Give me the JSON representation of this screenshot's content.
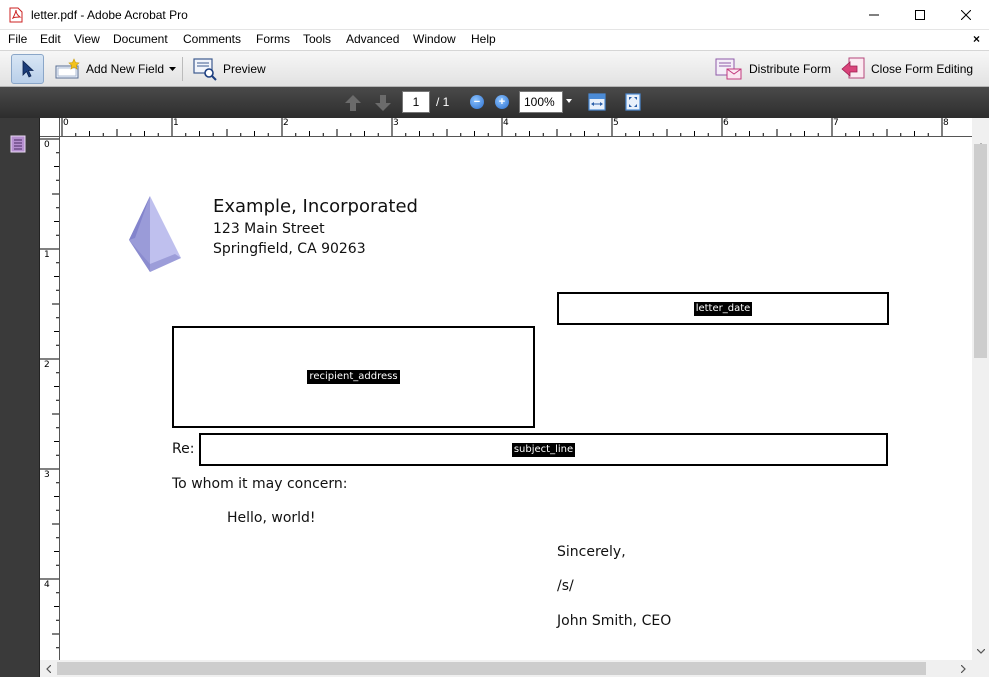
{
  "window": {
    "title": "letter.pdf - Adobe Acrobat Pro",
    "icon": "pdf-file-icon",
    "controls": [
      "minimize-icon",
      "maximize-icon",
      "close-icon"
    ]
  },
  "menu": {
    "items": [
      "File",
      "Edit",
      "View",
      "Document",
      "Comments",
      "Forms",
      "Tools",
      "Advanced",
      "Window",
      "Help"
    ],
    "close_doc": "×"
  },
  "toolbar": {
    "select_tool_icon": "arrow-pointer-icon",
    "add_new_field_label": "Add New Field",
    "preview_label": "Preview",
    "distribute_form_label": "Distribute Form",
    "close_form_editing_label": "Close Form Editing"
  },
  "page_nav": {
    "current_page": "1",
    "total_pages": "/ 1",
    "zoom_out": "−",
    "zoom_in": "+",
    "zoom_value": "100%"
  },
  "ruler": {
    "top_ticks": [
      "0",
      "1",
      "2",
      "3",
      "4",
      "5",
      "6",
      "7",
      "8"
    ],
    "left_ticks": [
      "0",
      "1",
      "2",
      "3",
      "4"
    ]
  },
  "document": {
    "company_name": "Example, Incorporated",
    "address_line1": "123 Main Street",
    "address_line2": "Springfield, CA 90263",
    "fields": {
      "letter_date": "letter_date",
      "recipient_address": "recipient_address",
      "subject_line": "subject_line"
    },
    "re_label": "Re:",
    "salutation": "To whom it may concern:",
    "body": "Hello, world!",
    "closing": "Sincerely,",
    "signature": "/s/",
    "signer": "John Smith, CEO"
  },
  "colors": {
    "logo_light": "#bfc0ee",
    "logo_mid": "#9a9bd8",
    "logo_dark": "#7f80c8",
    "nav_bar": "#333333",
    "sidebar": "#3a3a3a"
  }
}
